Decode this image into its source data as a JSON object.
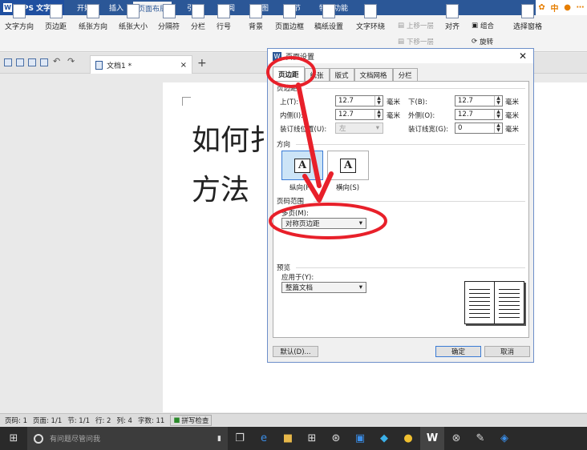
{
  "app": {
    "name": "WPS 文字"
  },
  "menu": [
    "开始",
    "插入",
    "页面布局",
    "引用",
    "审阅",
    "视图",
    "章节",
    "特色功能"
  ],
  "menu_active": "页面布局",
  "ribbon": {
    "text_direction": "文字方向",
    "margins": "页边距",
    "orientation": "纸张方向",
    "size": "纸张大小",
    "breaks": "分隔符",
    "columns": "分栏",
    "line_numbers": "行号",
    "background": "背景",
    "page_border": "页面边框",
    "manuscript": "稿纸设置",
    "text_wrap": "文字环绕",
    "bring_forward": "上移一层",
    "send_backward": "下移一层",
    "align": "对齐",
    "group": "组合",
    "rotate": "旋转",
    "selection_pane": "选择窗格"
  },
  "doc_tab": {
    "title": "文档1 *"
  },
  "document": {
    "line1": "如何扌",
    "line2": "方法 "
  },
  "dialog": {
    "title": "页面设置",
    "tabs": [
      "页边距",
      "纸张",
      "版式",
      "文档网格",
      "分栏"
    ],
    "active_tab": "页边距",
    "margins_section": "页边距",
    "top_label": "上(T):",
    "top_value": "12.7",
    "bottom_label": "下(B):",
    "bottom_value": "12.7",
    "inner_label": "内侧(I):",
    "inner_value": "12.7",
    "outer_label": "外侧(O):",
    "outer_value": "12.7",
    "gutter_pos_label": "装订线位置(U):",
    "gutter_pos_value": "左",
    "gutter_width_label": "装订线宽(G):",
    "gutter_width_value": "0",
    "unit": "毫米",
    "orientation_section": "方向",
    "portrait_label": "纵向(P)",
    "landscape_label": "横向(S)",
    "pages_section": "页码范围",
    "multi_label": "多页(M):",
    "multi_value": "对称页边距",
    "preview_section": "预览",
    "apply_label": "应用于(Y):",
    "apply_value": "整篇文档",
    "default_button": "默认(D)...",
    "ok_button": "确定",
    "cancel_button": "取消"
  },
  "status": {
    "page": "页码: 1",
    "pages": "页面: 1/1",
    "section": "节: 1/1",
    "row": "行: 2",
    "col": "列: 4",
    "words": "字数: 11",
    "spell": "拼写检查"
  },
  "taskbar": {
    "search_placeholder": "有问题尽管问我"
  },
  "colors": {
    "accent": "#2b5797",
    "annotation": "#e8202a"
  }
}
